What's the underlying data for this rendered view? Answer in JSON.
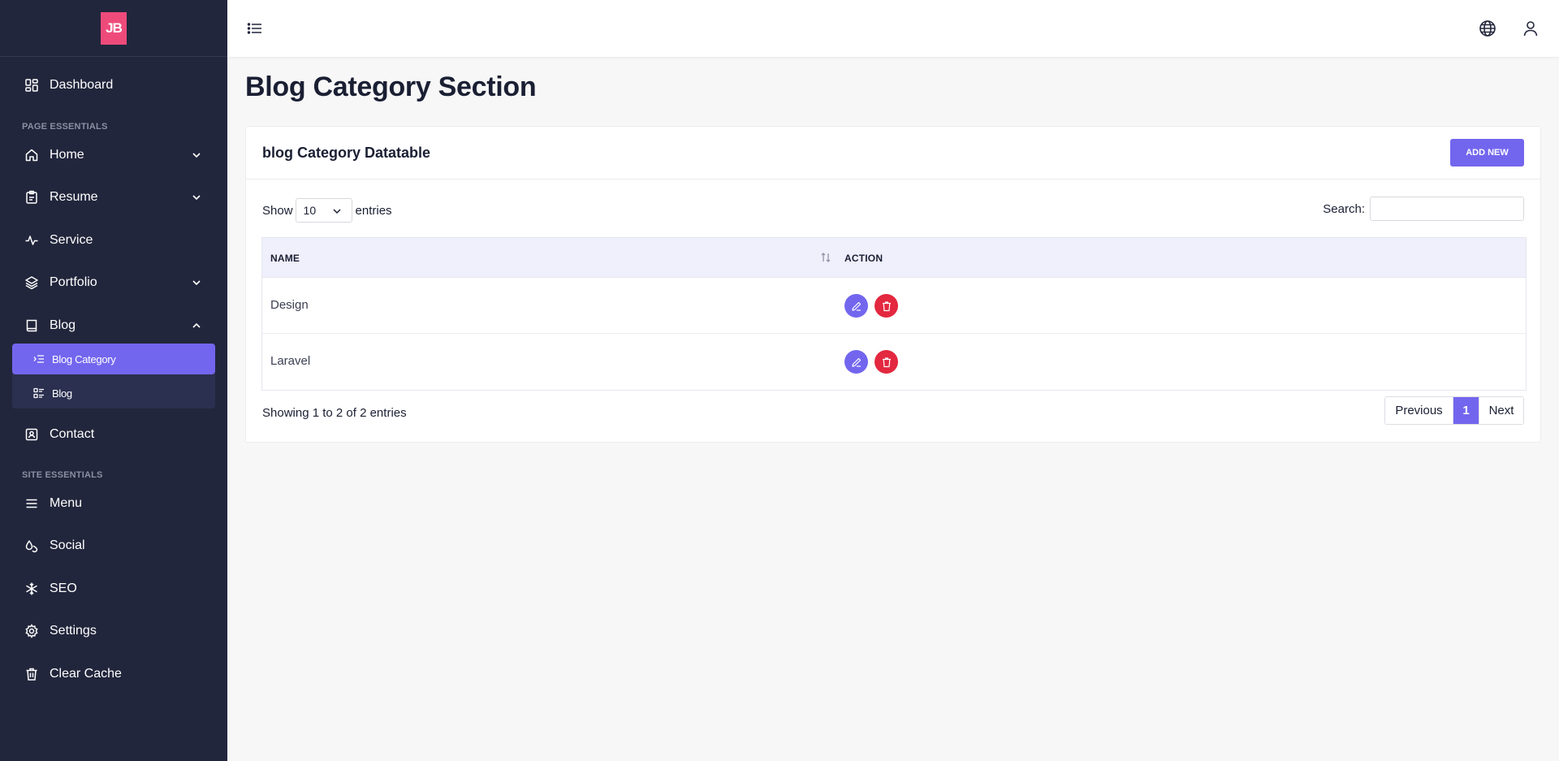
{
  "brand": {
    "logo_text": "JB",
    "logo_color": "#ee4b7b"
  },
  "colors": {
    "accent": "#7366ee",
    "danger": "#e3283f",
    "sidebar_bg": "#22263c"
  },
  "sidebar": {
    "dashboard": "Dashboard",
    "section_page": "PAGE ESSENTIALS",
    "home": "Home",
    "resume": "Resume",
    "service": "Service",
    "portfolio": "Portfolio",
    "blog": "Blog",
    "blog_sub": {
      "category": "Blog Category",
      "blog": "Blog"
    },
    "contact": "Contact",
    "section_site": "SITE ESSENTIALS",
    "menu": "Menu",
    "social": "Social",
    "seo": "SEO",
    "settings": "Settings",
    "clear_cache": "Clear Cache"
  },
  "topbar": {
    "icons": [
      "menu-toggle-icon",
      "globe-icon",
      "user-icon"
    ]
  },
  "page": {
    "title": "Blog Category Section"
  },
  "card": {
    "title": "blog Category Datatable",
    "add_button": "ADD NEW",
    "show_label": "Show",
    "entries_value": "10",
    "entries_label": "entries",
    "search_label": "Search:",
    "search_value": "",
    "columns": {
      "name": "NAME",
      "action": "ACTION"
    },
    "rows": [
      {
        "name": "Design"
      },
      {
        "name": "Laravel"
      }
    ],
    "info": "Showing 1 to 2 of 2 entries",
    "pagination": {
      "previous": "Previous",
      "current": "1",
      "next": "Next"
    }
  }
}
